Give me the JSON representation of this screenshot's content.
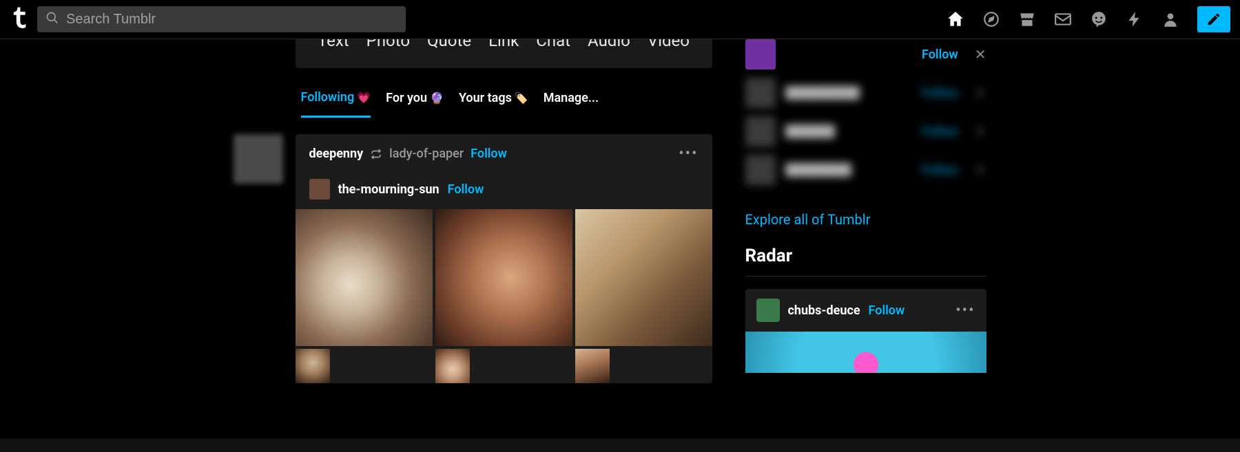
{
  "search": {
    "placeholder": "Search Tumblr"
  },
  "nav_icons": [
    "home",
    "explore",
    "store",
    "inbox",
    "messaging",
    "activity",
    "account"
  ],
  "post_types": [
    "Text",
    "Photo",
    "Quote",
    "Link",
    "Chat",
    "Audio",
    "Video"
  ],
  "tabs": [
    {
      "label": "Following",
      "emoji": "💗",
      "active": true
    },
    {
      "label": "For you",
      "emoji": "🔮",
      "active": false
    },
    {
      "label": "Your tags",
      "emoji": "🏷️",
      "active": false
    },
    {
      "label": "Manage...",
      "emoji": "",
      "active": false
    }
  ],
  "post": {
    "reblogger": "deepenny",
    "source": "lady-of-paper",
    "source_follow": "Follow",
    "op": "the-mourning-sun",
    "op_follow": "Follow"
  },
  "recommendations": [
    {
      "name": "",
      "follow": "Follow",
      "blurred": false,
      "avatar": "purple"
    },
    {
      "name": "",
      "follow": "Follow",
      "blurred": true,
      "avatar": "gray"
    },
    {
      "name": "",
      "follow": "Follow",
      "blurred": true,
      "avatar": "gray"
    },
    {
      "name": "",
      "follow": "Follow",
      "blurred": true,
      "avatar": "gray"
    }
  ],
  "explore_link": "Explore all of Tumblr",
  "radar": {
    "title": "Radar",
    "user": "chubs-deuce",
    "follow": "Follow"
  },
  "colors": {
    "accent": "#00b8ff"
  }
}
